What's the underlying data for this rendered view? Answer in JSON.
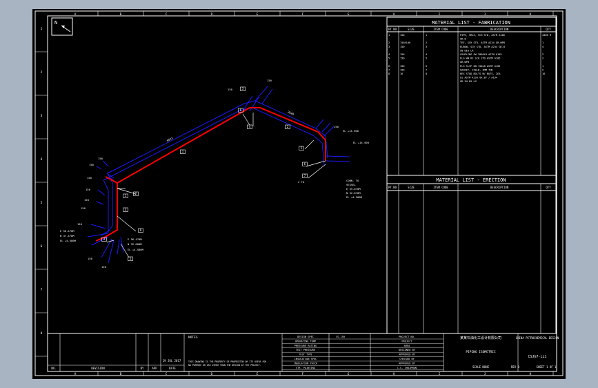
{
  "viewer": {
    "background": "#a9b4c2",
    "canvas_color": "#000000"
  },
  "colors": {
    "pipe_blue": "#1a1aff",
    "pipe_red": "#ff0000",
    "frame": "#ffffff"
  },
  "north": {
    "label": "N"
  },
  "grid_cols": [
    "A",
    "B",
    "C",
    "D",
    "E",
    "F",
    "G",
    "H",
    "I",
    "J",
    "K",
    "L"
  ],
  "grid_rows": [
    "1",
    "2",
    "3",
    "4",
    "5",
    "6",
    "7",
    "8"
  ],
  "fabrication": {
    "title": "MATERIAL LIST - FABRICATION",
    "headers": [
      "PT.NO",
      "SIZE",
      "ITEM CODE",
      "DESCRIPTION",
      "QTY"
    ],
    "rows": [
      [
        "1",
        "150",
        "1",
        "PIPE, SMLS, SCH STD, ASTM A106",
        "4400 M"
      ],
      [
        "",
        "",
        "",
        "GR.B",
        ""
      ],
      [
        "2",
        "150X100",
        "2",
        "TEE, SCH STD, ASTM A234 GR.WPB",
        "1"
      ],
      [
        "3",
        "150",
        "3",
        "ELBOW, SCH STD, ASTM A234 GR.B",
        "4"
      ],
      [
        "",
        "",
        "",
        "90 DEG LR",
        ""
      ],
      [
        "4",
        "150",
        "4",
        "COUPLING SW 3000LB ASTM A105",
        "2"
      ],
      [
        "5",
        "150",
        "5",
        "FLG WN RF SCH STD ASTM A105",
        "2"
      ],
      [
        "",
        "",
        "",
        "GR.WPB",
        ""
      ],
      [
        "6",
        "150",
        "6",
        "FLG SLIP ON 150LB ASTM A105",
        "1"
      ],
      [
        "7",
        "150",
        "7",
        "GASKET, 150LB, 3MM THK",
        "2"
      ],
      [
        "8",
        "16",
        "8",
        "HEX STUD BOLTS W/ NUTS, 2EA",
        "16"
      ],
      [
        "",
        "",
        "",
        "LG ASTM A193 GR.B7 / A194",
        ""
      ],
      [
        "",
        "",
        "",
        "GR 2H 85 LG",
        ""
      ]
    ]
  },
  "erection": {
    "title": "MATERIAL LIST - ERECTION",
    "headers": [
      "PT.NO",
      "SIZE",
      "ITEM CODE",
      "DESCRIPTION",
      "QTY"
    ]
  },
  "drawing": {
    "labels": {
      "l150_1": "150",
      "l150_2": "150",
      "l150_3": "150",
      "l150_4": "150",
      "l150_5": "150",
      "l150_6": "150",
      "l150_7": "150",
      "l150_8": "150",
      "l150_9": "150",
      "l150_10": "150",
      "l150_11": "150",
      "l150_12": "150",
      "dim1": "6011",
      "dim2": "2640",
      "elev1": "EL +14.500",
      "elev2": "EL +14.500",
      "elev3": "E 56.470M",
      "elev4": "N 37.470M",
      "elev5": "EL +4.500M",
      "elev6": "E 56.470M",
      "elev7": "N 32.600M",
      "elev8": "EL +4.500M",
      "conn1": "CONN. TO",
      "conn2": "VESSEL",
      "conn3": "E 55.870M",
      "conn4": "N 32.870M",
      "conn5": "EL +4.500M",
      "tag": "2 TO",
      "c1": "1",
      "c2": "2",
      "c3": "3",
      "c4": "4",
      "c5": "5",
      "c6": "6",
      "c7": "7",
      "c8": "8"
    }
  },
  "title_block": {
    "notes": "NOTES",
    "note_text1": "THIS DRAWING IS THE PROPERTY OF PROPRIETOR OR ITS USERS FOR",
    "note_text2": "NO PURPOSE OR USE OTHER THAN THE DESIGN OF THE PROJECT.",
    "rev_labels": [
      "NO.",
      "REVISION",
      "BY",
      "APP",
      "DATE"
    ],
    "date": "19 JUL 2017",
    "date2": "DATE",
    "params": [
      "DESIGN SPEC",
      "OPERATING TEMP",
      "PRESSURE RATING",
      "TEST PRESSURE",
      "TEST TYPE",
      "INSULATION SPEC",
      "INSULATION THICK",
      "STR. PAINTING"
    ],
    "param_values": [
      "CS-150",
      "",
      "",
      "",
      "",
      "",
      "",
      ""
    ],
    "project_labels": [
      "PROJECT NO.",
      "PROJECT",
      "AREA",
      "DESIGNED BY",
      "APPROVED BY",
      "CHECKED BY",
      "APPROVED BY",
      "C.L. CHAIRMAN"
    ],
    "company_cn": "某某石油化工设计有限公司",
    "company_en": "CHINA PETROCHEMICAL DESIGN",
    "dwg_title": "PIPING ISOMETRIC",
    "dwg_no": "CSJG7-LL1",
    "sheet": "SHEET 1 OF 1",
    "scale": "SCALE NONE",
    "rev": "REV 0",
    "stamp": "印"
  }
}
